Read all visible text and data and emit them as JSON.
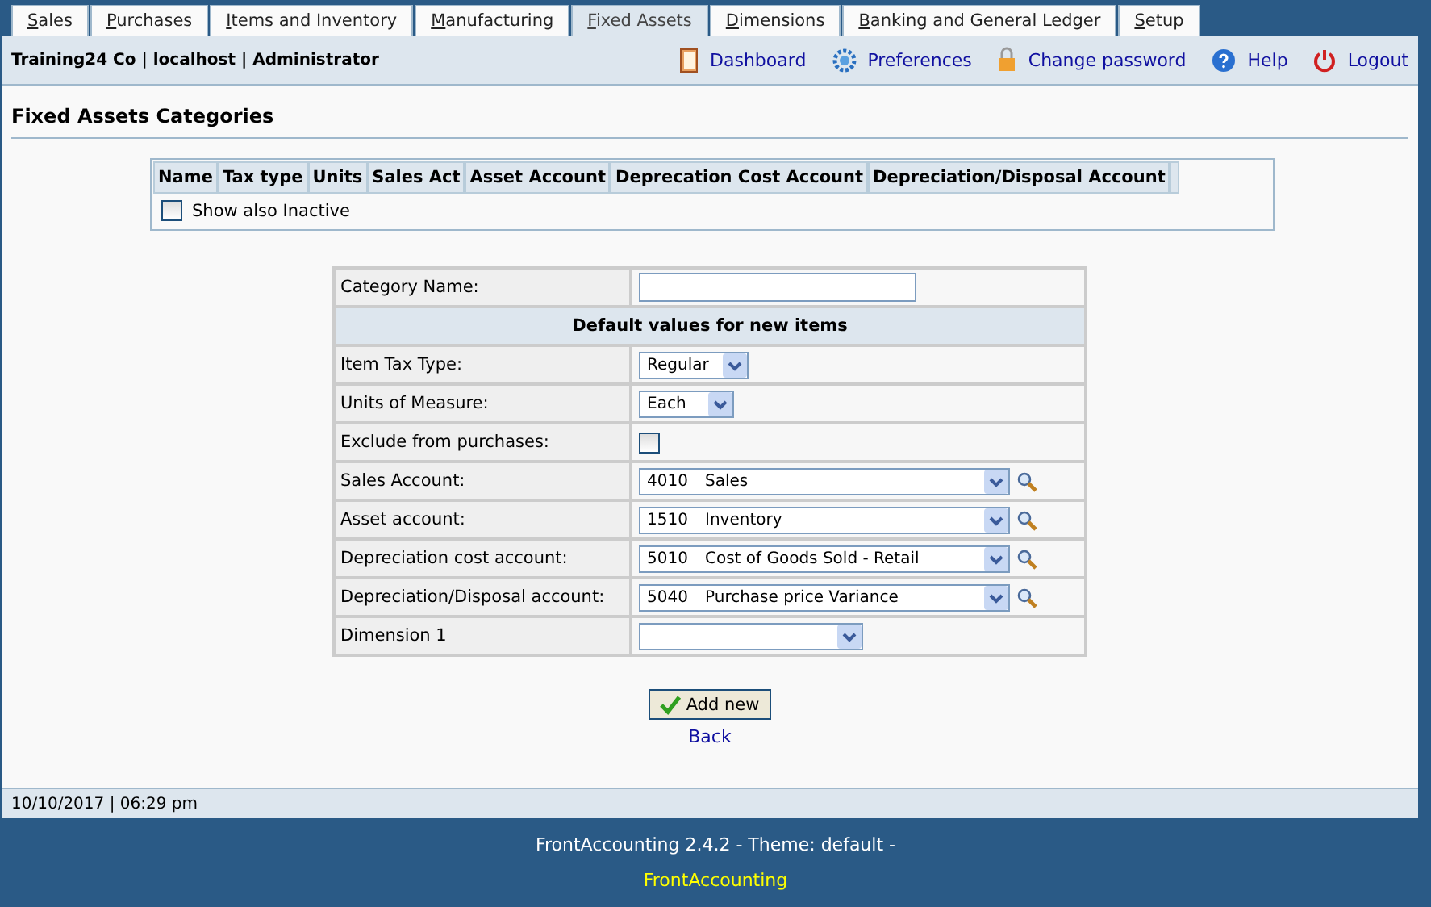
{
  "tabs": [
    {
      "label": "Sales",
      "selected": false
    },
    {
      "label": "Purchases",
      "selected": false
    },
    {
      "label": "Items and Inventory",
      "selected": false
    },
    {
      "label": "Manufacturing",
      "selected": false
    },
    {
      "label": "Fixed Assets",
      "selected": true
    },
    {
      "label": "Dimensions",
      "selected": false
    },
    {
      "label": "Banking and General Ledger",
      "selected": false
    },
    {
      "label": "Setup",
      "selected": false
    }
  ],
  "header": {
    "company": "Training24 Co | localhost | Administrator",
    "links": [
      {
        "label": "Dashboard"
      },
      {
        "label": "Preferences"
      },
      {
        "label": "Change password"
      },
      {
        "label": "Help"
      },
      {
        "label": "Logout"
      }
    ]
  },
  "page_title": "Fixed Assets Categories",
  "table": {
    "columns": [
      "Name",
      "Tax type",
      "Units",
      "Sales Act",
      "Asset Account",
      "Deprecation Cost Account",
      "Depreciation/Disposal Account"
    ],
    "show_inactive": {
      "label": "Show also Inactive",
      "checked": false
    }
  },
  "form": {
    "name_label": "Category Name:",
    "section": "Default values for new items",
    "rows": [
      {
        "kind": "select",
        "label": "Item Tax Type:",
        "value": "Regular"
      },
      {
        "kind": "select",
        "label": "Units of Measure:",
        "value": "Each"
      },
      {
        "kind": "checkbox",
        "label": "Exclude from purchases:",
        "checked": false
      },
      {
        "kind": "account",
        "label": "Sales Account:",
        "code": "4010",
        "name": "Sales"
      },
      {
        "kind": "account",
        "label": "Asset account:",
        "code": "1510",
        "name": "Inventory"
      },
      {
        "kind": "account",
        "label": "Depreciation cost account:",
        "code": "5010",
        "name": "Cost of Goods Sold - Retail"
      },
      {
        "kind": "account",
        "label": "Depreciation/Disposal account:",
        "code": "5040",
        "name": "Purchase price Variance"
      },
      {
        "kind": "select_wide",
        "label": "Dimension 1"
      }
    ]
  },
  "add_button": "Add new",
  "back_link": "Back",
  "status_bar": "10/10/2017 | 06:29 pm",
  "footer": {
    "version": "FrontAccounting 2.4.2 - Theme: default -",
    "link": "FrontAccounting"
  }
}
